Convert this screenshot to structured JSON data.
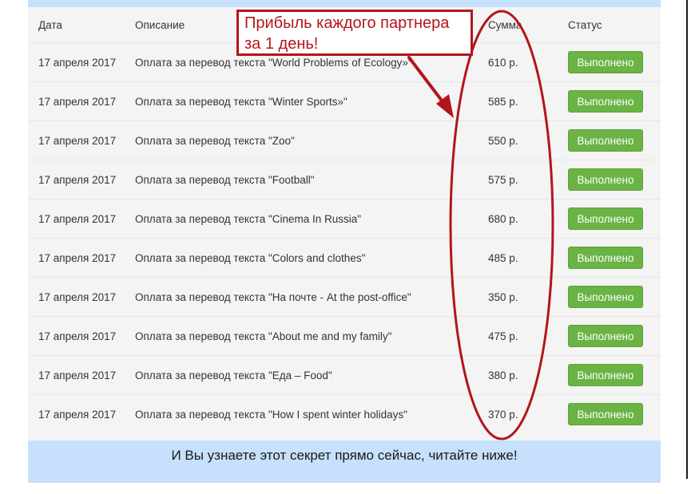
{
  "table": {
    "headers": {
      "date": "Дата",
      "description": "Описание",
      "sum": "Сумма",
      "status": "Статус"
    },
    "rows": [
      {
        "date": "17 апреля 2017",
        "description": "Оплата за перевод текста \"World Problems of Ecology»\"",
        "sum": "610 р.",
        "status": "Выполнено"
      },
      {
        "date": "17 апреля 2017",
        "description": "Оплата за перевод текста \"Winter Sports»\"",
        "sum": "585 р.",
        "status": "Выполнено"
      },
      {
        "date": "17 апреля 2017",
        "description": "Оплата за перевод текста \"Zoo\"",
        "sum": "550 р.",
        "status": "Выполнено"
      },
      {
        "date": "17 апреля 2017",
        "description": "Оплата за перевод текста \"Football\"",
        "sum": "575 р.",
        "status": "Выполнено"
      },
      {
        "date": "17 апреля 2017",
        "description": "Оплата за перевод текста \"Cinema In Russia\"",
        "sum": "680 р.",
        "status": "Выполнено"
      },
      {
        "date": "17 апреля 2017",
        "description": "Оплата за перевод текста \"Colors and clothes\"",
        "sum": "485 р.",
        "status": "Выполнено"
      },
      {
        "date": "17 апреля 2017",
        "description": "Оплата за перевод текста \"На почте - At the post-office\"",
        "sum": "350 р.",
        "status": "Выполнено"
      },
      {
        "date": "17 апреля 2017",
        "description": "Оплата за перевод текста \"About me and my family\"",
        "sum": "475 р.",
        "status": "Выполнено"
      },
      {
        "date": "17 апреля 2017",
        "description": "Оплата за перевод текста \"Еда – Food\"",
        "sum": "380 р.",
        "status": "Выполнено"
      },
      {
        "date": "17 апреля 2017",
        "description": "Оплата за перевод текста \"How I spent winter holidays\"",
        "sum": "370 р.",
        "status": "Выполнено"
      }
    ]
  },
  "annotation": {
    "line1": "Прибыль каждого партнера",
    "line2": "за 1 день!",
    "color": "#b3151b"
  },
  "footer": {
    "text": "И Вы узнаете этот секрет прямо сейчас, читайте ниже!"
  },
  "colors": {
    "status_button": "#6ab344",
    "band": "#c7e0fb",
    "table_bg": "#f4f4f4"
  }
}
